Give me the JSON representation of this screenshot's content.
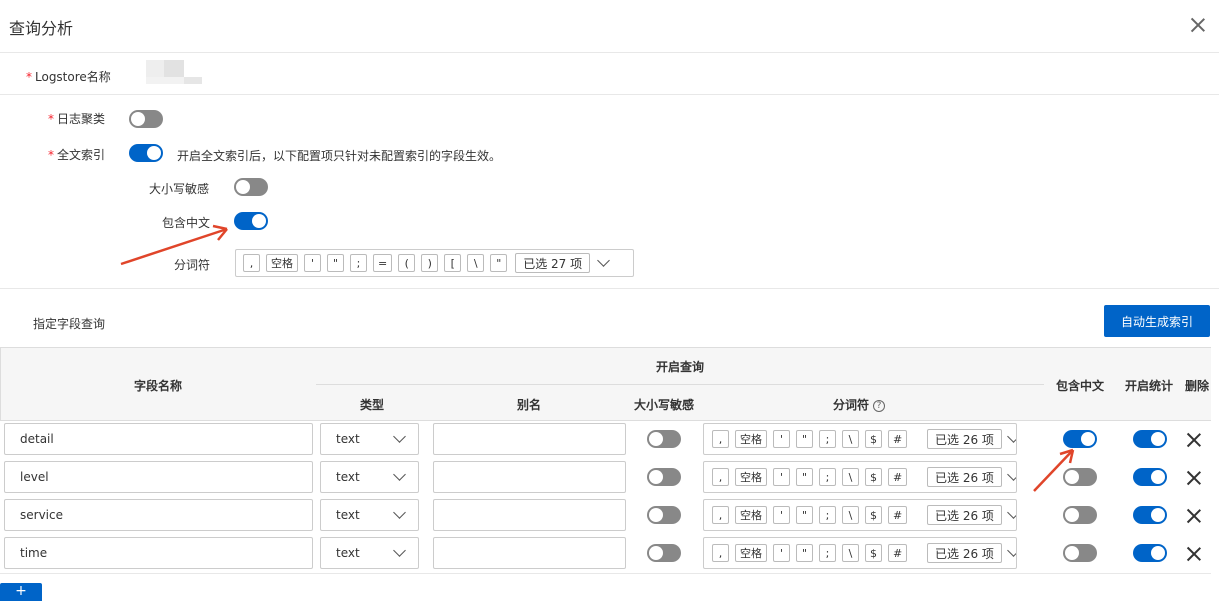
{
  "dialog": {
    "title": "查询分析"
  },
  "logstore": {
    "label": "Logstore名称"
  },
  "log_cluster": {
    "label": "日志聚类",
    "enabled": false
  },
  "fulltext": {
    "label": "全文索引",
    "enabled": true,
    "hint": "开启全文索引后，以下配置项只针对未配置索引的字段生效。"
  },
  "case_sensitive": {
    "label": "大小写敏感",
    "enabled": false
  },
  "include_chinese": {
    "label": "包含中文",
    "enabled": true
  },
  "delimiter": {
    "label": "分词符",
    "tokens": [
      ",",
      "空格",
      "'",
      "\"",
      ";",
      "=",
      "(",
      ")",
      "[",
      "\\",
      "\""
    ],
    "selected": "已选 27 项"
  },
  "field_query": {
    "label": "指定字段查询",
    "auto_button": "自动生成索引"
  },
  "table": {
    "headers": {
      "field_name": "字段名称",
      "enable_query": "开启查询",
      "type": "类型",
      "alias": "别名",
      "case_sensitive": "大小写敏感",
      "delimiter": "分词符",
      "help": "?",
      "include_chinese": "包含中文",
      "enable_stats": "开启统计",
      "delete": "删除"
    },
    "row_tokens": [
      ",",
      "空格",
      "'",
      "\"",
      ";",
      "\\",
      "$",
      "#"
    ],
    "rows": [
      {
        "name": "detail",
        "type": "text",
        "alias": "",
        "case_sensitive": false,
        "delims_selected": "已选 26 项",
        "include_chinese": true,
        "stats": true
      },
      {
        "name": "level",
        "type": "text",
        "alias": "",
        "case_sensitive": false,
        "delims_selected": "已选 26 项",
        "include_chinese": false,
        "stats": true
      },
      {
        "name": "service",
        "type": "text",
        "alias": "",
        "case_sensitive": false,
        "delims_selected": "已选 26 项",
        "include_chinese": false,
        "stats": true
      },
      {
        "name": "time",
        "type": "text",
        "alias": "",
        "case_sensitive": false,
        "delims_selected": "已选 26 项",
        "include_chinese": false,
        "stats": true
      }
    ]
  },
  "add_button": {
    "label": "+"
  },
  "icons": {
    "close": "close-icon",
    "chevron": "chevron-down-icon",
    "delete": "delete-x-icon",
    "help": "help-circle-icon"
  },
  "colors": {
    "accent": "#0064c8",
    "toggle_off": "#888888",
    "annotation_arrow": "#e0452a"
  }
}
